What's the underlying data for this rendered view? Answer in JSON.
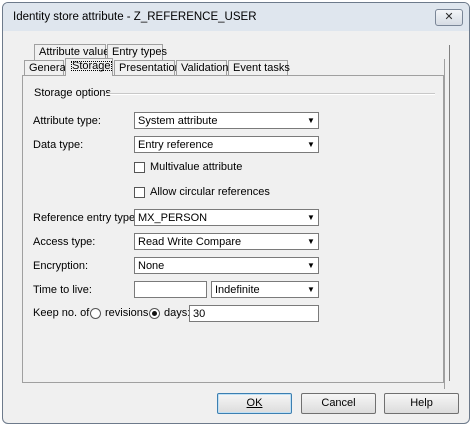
{
  "window": {
    "title": "Identity store attribute - Z_REFERENCE_USER",
    "close_glyph": "✕"
  },
  "tabs_top": [
    "Attribute values",
    "Entry types"
  ],
  "tabs_bottom": [
    "General",
    "Storage",
    "Presentation",
    "Validation",
    "Event tasks"
  ],
  "active_tab": "Storage",
  "storage": {
    "group_label": "Storage options",
    "attribute_type": {
      "label": "Attribute type:",
      "value": "System attribute"
    },
    "data_type": {
      "label": "Data type:",
      "value": "Entry reference"
    },
    "multivalue": {
      "label": "Multivalue attribute",
      "checked": false
    },
    "circular": {
      "label": "Allow circular references",
      "checked": false
    },
    "reference_entry_type": {
      "label": "Reference entry type:",
      "value": "MX_PERSON"
    },
    "access_type": {
      "label": "Access type:",
      "value": "Read Write Compare"
    },
    "encryption": {
      "label": "Encryption:",
      "value": "None"
    },
    "time_to_live": {
      "label": "Time to live:",
      "value": "",
      "unit": "Indefinite"
    },
    "keep": {
      "label": "Keep no. of",
      "revisions_label": "revisions",
      "days_label": "days:",
      "selected": "days",
      "days_value": "30"
    }
  },
  "buttons": {
    "ok": "OK",
    "cancel": "Cancel",
    "help": "Help"
  },
  "icons": {
    "dropdown": "▼"
  }
}
